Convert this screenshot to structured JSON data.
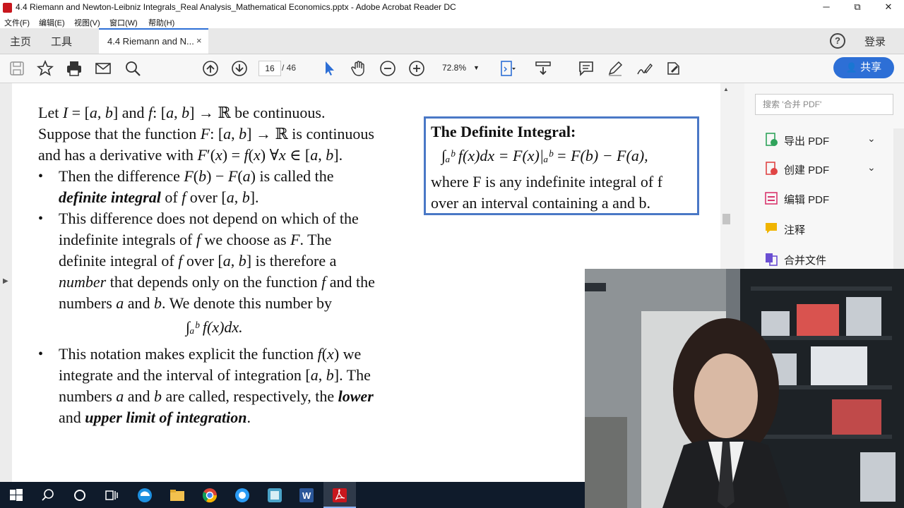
{
  "window": {
    "title": "4.4 Riemann and Newton-Leibniz Integrals_Real Analysis_Mathematical Economics.pptx - Adobe Acrobat Reader DC",
    "minimize": "─",
    "restore": "⧉",
    "close": "✕"
  },
  "menu": [
    "文件(F)",
    "编辑(E)",
    "视图(V)",
    "窗口(W)",
    "帮助(H)"
  ],
  "tabs": {
    "home": "主页",
    "tools": "工具",
    "document": "4.4 Riemann and N...",
    "close": "×",
    "help": "?",
    "login": "登录"
  },
  "toolbar": {
    "page_current": "16",
    "page_total": "/ 46",
    "zoom": "72.8%",
    "share": "共享"
  },
  "slide": {
    "intro": [
      "Let I = [a, b] and f: [a, b] → ℝ be continuous.",
      "Suppose that the function F: [a, b] → ℝ is continuous",
      "and has a derivative with F′(x) = f(x) ∀x ∈ [a, b]."
    ],
    "b1": [
      "Then the difference F(b) − F(a) is called the",
      "definite integral of f over [a, b]."
    ],
    "b2": [
      "This difference does not depend on which of the",
      "indefinite integrals of f we choose as F. The",
      "definite integral of f over [a, b] is therefore a",
      "number that depends only on the function f and the",
      "numbers a and b. We denote this number by"
    ],
    "formula": "∫ₐᵇ f(x)dx.",
    "b3": [
      "This notation makes explicit the function f(x) we",
      "integrate and the interval of integration [a, b]. The",
      "numbers a and b are called, respectively, the lower",
      "and upper limit of integration."
    ],
    "box": {
      "title": "The Definite Integral:",
      "formula": "∫ₐᵇ f(x)dx = F(x)|ₐᵇ = F(b) − F(a),",
      "l1": "where F is any indefinite integral of f",
      "l2": "over an interval containing a and b."
    }
  },
  "right_panel": {
    "search_placeholder": "搜索 '合并 PDF'",
    "items": [
      {
        "label": "导出 PDF",
        "color": "#2fa35b"
      },
      {
        "label": "创建 PDF",
        "color": "#e04545"
      },
      {
        "label": "编辑 PDF",
        "color": "#d9376e"
      },
      {
        "label": "注释",
        "color": "#f0b400"
      },
      {
        "label": "合并文件",
        "color": "#6b4fd3"
      }
    ]
  },
  "colors": {
    "accent": "#2d6fd6",
    "box_border": "#4a78c6"
  }
}
